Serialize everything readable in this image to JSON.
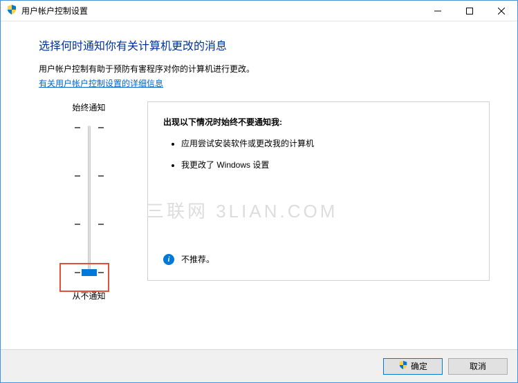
{
  "titlebar": {
    "title": "用户帐户控制设置"
  },
  "content": {
    "heading": "选择何时通知你有关计算机更改的消息",
    "subtext": "用户帐户控制有助于预防有害程序对你的计算机进行更改。",
    "link": "有关用户帐户控制设置的详细信息"
  },
  "slider": {
    "top_label": "始终通知",
    "bottom_label": "从不通知"
  },
  "info_box": {
    "heading": "出现以下情况时始终不要通知我:",
    "items": [
      "应用尝试安装软件或更改我的计算机",
      "我更改了 Windows 设置"
    ],
    "footer": "不推荐。"
  },
  "buttons": {
    "ok": "确定",
    "cancel": "取消"
  },
  "watermark": "三联网 3LIAN.COM"
}
